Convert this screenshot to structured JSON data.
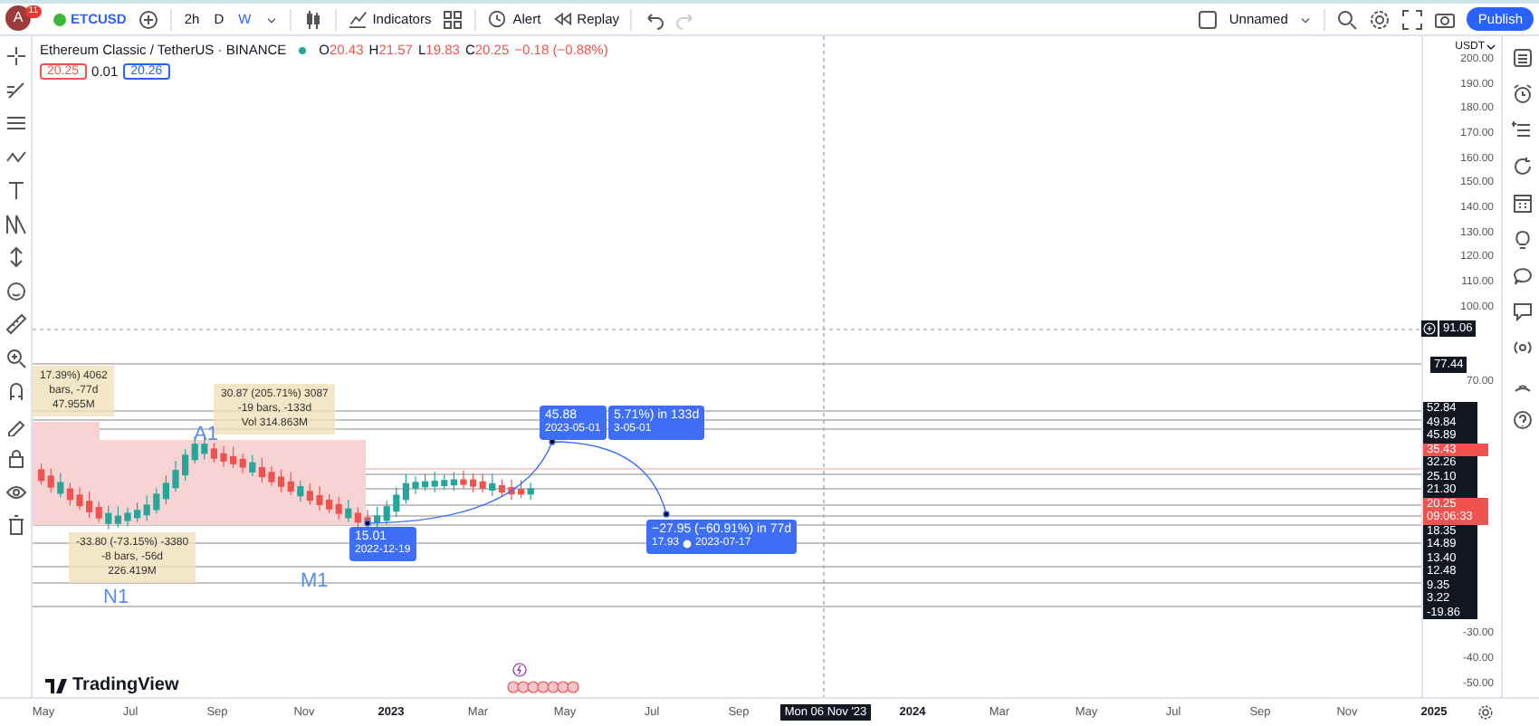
{
  "toolbar": {
    "avatar": "A",
    "badge": "11",
    "symbol": "ETCUSD",
    "intervals": [
      {
        "label": "2h",
        "selected": false
      },
      {
        "label": "D",
        "selected": false
      },
      {
        "label": "W",
        "selected": true
      }
    ],
    "actions": [
      {
        "kind": "indicators",
        "label": "Indicators"
      },
      {
        "kind": "alert",
        "label": "Alert"
      },
      {
        "kind": "replay",
        "label": "Replay"
      }
    ],
    "layout_name": "Unnamed",
    "publish": "Publish"
  },
  "legend": {
    "title": "Ethereum Classic / TetherUS · BINANCE",
    "ohlc": [
      {
        "key": "O",
        "value": "20.43"
      },
      {
        "key": "H",
        "value": "21.57"
      },
      {
        "key": "L",
        "value": "19.83"
      },
      {
        "key": "C",
        "value": "20.25"
      }
    ],
    "change": "−0.18 (−0.88%)",
    "bid": "20.25",
    "spread": "0.01",
    "ask": "20.26"
  },
  "annotations": [
    {
      "kind": "measure",
      "lines": [
        "17.39%) 4062",
        "bars, -77d",
        "47.955M"
      ]
    },
    {
      "kind": "measure",
      "lines": [
        "30.87 (205.71%) 3087",
        "-19 bars, -133d",
        "Vol 314.863M"
      ]
    },
    {
      "kind": "measure",
      "lines": [
        "-33.80 (-73.15%) -3380",
        "-8 bars, -56d",
        "226.419M"
      ]
    },
    {
      "kind": "wave",
      "lines": [
        "A1"
      ]
    },
    {
      "kind": "wave",
      "lines": [
        "N1"
      ]
    },
    {
      "kind": "wave",
      "lines": [
        "M1"
      ]
    },
    {
      "kind": "point",
      "lines": [
        "15.01",
        "2022-12-19"
      ]
    },
    {
      "kind": "point",
      "lines": [
        "45.88",
        "2023-05-01"
      ]
    },
    {
      "kind": "point",
      "lines": [
        "5.71%) in 133d",
        "3-05-01"
      ]
    },
    {
      "kind": "target",
      "lines": [
        "−27.95 (−60.91%) in 77d",
        "17.93",
        "2023-07-17"
      ]
    }
  ],
  "brand": "TradingView",
  "price_axis": {
    "currency": "USDT",
    "ticks": [
      "200.00",
      "190.00",
      "180.00",
      "170.00",
      "160.00",
      "150.00",
      "140.00",
      "130.00",
      "120.00",
      "110.00",
      "100.00",
      "70.00"
    ],
    "lower_ticks": [
      "-30.00",
      "-40.00",
      "-50.00"
    ],
    "crosshair": "91.06",
    "level": "77.44",
    "stack": [
      {
        "kind": "level",
        "lines": [
          "52.84"
        ]
      },
      {
        "kind": "level",
        "lines": [
          "49.84"
        ]
      },
      {
        "kind": "level",
        "lines": [
          "45.89"
        ]
      },
      {
        "kind": "alert",
        "lines": [
          "35.43"
        ]
      },
      {
        "kind": "level",
        "lines": [
          "32.26"
        ]
      },
      {
        "kind": "level",
        "lines": [
          "25.10"
        ]
      },
      {
        "kind": "level",
        "lines": [
          "21.30"
        ]
      },
      {
        "kind": "alert",
        "lines": [
          "20.25",
          "09:06:33"
        ]
      },
      {
        "kind": "level",
        "lines": [
          "18.35"
        ]
      },
      {
        "kind": "level",
        "lines": [
          "14.89"
        ]
      },
      {
        "kind": "level",
        "lines": [
          "13.40"
        ]
      },
      {
        "kind": "level",
        "lines": [
          "12.48"
        ]
      },
      {
        "kind": "level",
        "lines": [
          "9.35"
        ]
      },
      {
        "kind": "level",
        "lines": [
          "3.22"
        ]
      },
      {
        "kind": "level",
        "lines": [
          "-19.86"
        ]
      }
    ]
  },
  "time_axis": {
    "labels": [
      {
        "text": "May",
        "kind": "month"
      },
      {
        "text": "Jul",
        "kind": "month"
      },
      {
        "text": "Sep",
        "kind": "month"
      },
      {
        "text": "Nov",
        "kind": "month"
      },
      {
        "text": "2023",
        "kind": "year"
      },
      {
        "text": "Mar",
        "kind": "month"
      },
      {
        "text": "May",
        "kind": "month"
      },
      {
        "text": "Jul",
        "kind": "month"
      },
      {
        "text": "Sep",
        "kind": "month"
      },
      {
        "text": "2024",
        "kind": "year"
      },
      {
        "text": "Mar",
        "kind": "month"
      },
      {
        "text": "May",
        "kind": "month"
      },
      {
        "text": "Jul",
        "kind": "month"
      },
      {
        "text": "Sep",
        "kind": "month"
      },
      {
        "text": "Nov",
        "kind": "month"
      },
      {
        "text": "2025",
        "kind": "year"
      }
    ],
    "crosshair": "Mon 06 Nov '23"
  }
}
